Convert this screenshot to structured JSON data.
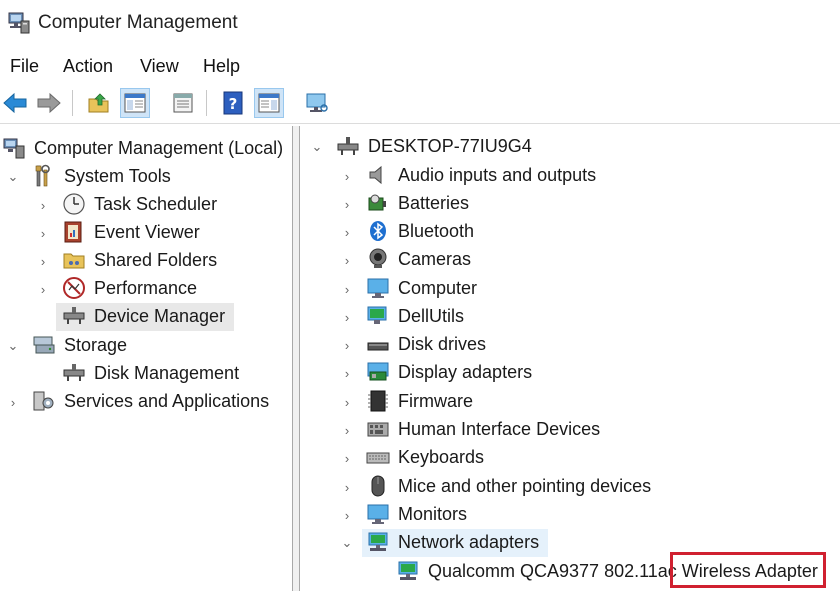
{
  "window": {
    "title": "Computer Management"
  },
  "menu": [
    "File",
    "Action",
    "View",
    "Help"
  ],
  "left_tree": {
    "root": "Computer Management (Local)",
    "system_tools": "System Tools",
    "task_scheduler": "Task Scheduler",
    "event_viewer": "Event Viewer",
    "shared_folders": "Shared Folders",
    "performance": "Performance",
    "device_manager": "Device Manager",
    "storage": "Storage",
    "disk_management": "Disk Management",
    "services": "Services and Applications"
  },
  "right_tree": {
    "computer_name": "DESKTOP-77IU9G4",
    "categories": [
      "Audio inputs and outputs",
      "Batteries",
      "Bluetooth",
      "Cameras",
      "Computer",
      "DellUtils",
      "Disk drives",
      "Display adapters",
      "Firmware",
      "Human Interface Devices",
      "Keyboards",
      "Mice and other pointing devices",
      "Monitors",
      "Network adapters"
    ],
    "network_child": "Qualcomm QCA9377 802.11ac Wireless Adapter"
  },
  "colors": {
    "selection": "#e5f1fb",
    "highlight": "#d02030",
    "accent": "#1e78c8"
  }
}
